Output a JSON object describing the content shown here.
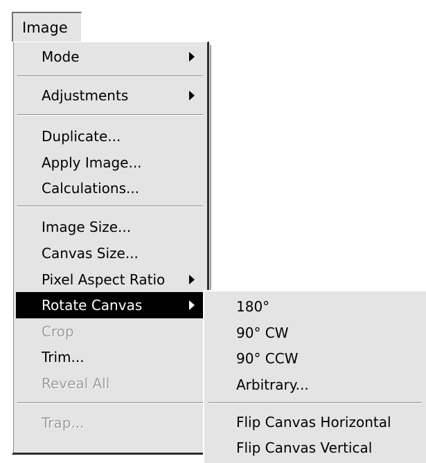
{
  "menubar": {
    "label": "Image"
  },
  "main_menu": {
    "items": [
      {
        "label": "Mode",
        "submenu": true,
        "enabled": true
      },
      {
        "label": "Adjustments",
        "submenu": true,
        "enabled": true
      },
      {
        "label": "Duplicate...",
        "submenu": false,
        "enabled": true
      },
      {
        "label": "Apply Image...",
        "submenu": false,
        "enabled": true
      },
      {
        "label": "Calculations...",
        "submenu": false,
        "enabled": true
      },
      {
        "label": "Image Size...",
        "submenu": false,
        "enabled": true
      },
      {
        "label": "Canvas Size...",
        "submenu": false,
        "enabled": true
      },
      {
        "label": "Pixel Aspect Ratio",
        "submenu": true,
        "enabled": true
      },
      {
        "label": "Rotate Canvas",
        "submenu": true,
        "enabled": true,
        "highlighted": true
      },
      {
        "label": "Crop",
        "submenu": false,
        "enabled": false
      },
      {
        "label": "Trim...",
        "submenu": false,
        "enabled": true
      },
      {
        "label": "Reveal All",
        "submenu": false,
        "enabled": false
      },
      {
        "label": "Trap...",
        "submenu": false,
        "enabled": false
      }
    ]
  },
  "rotate_submenu": {
    "items": [
      {
        "label": "180°"
      },
      {
        "label": "90° CW"
      },
      {
        "label": "90° CCW"
      },
      {
        "label": "Arbitrary..."
      },
      {
        "label": "Flip Canvas Horizontal"
      },
      {
        "label": "Flip Canvas Vertical"
      }
    ]
  },
  "colors": {
    "menu_background": "#e4e4e4",
    "highlight_background": "#000000",
    "highlight_text": "#ffffff",
    "disabled_text": "#9e9e9e"
  }
}
